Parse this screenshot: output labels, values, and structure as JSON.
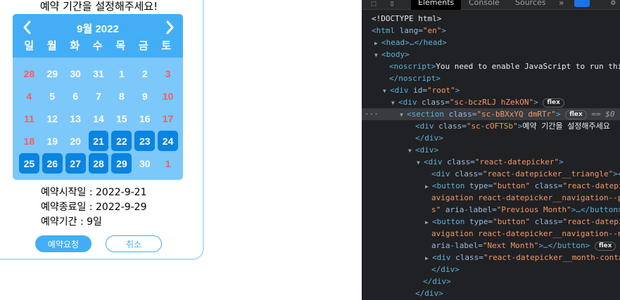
{
  "page": {
    "heading": "예약 기간을 설정해주세요!"
  },
  "datepicker": {
    "month_title": "9월 2022",
    "weekdays": [
      "일",
      "월",
      "화",
      "수",
      "목",
      "금",
      "토"
    ],
    "weeks": [
      [
        "28",
        "29",
        "30",
        "31",
        "1",
        "2",
        "3"
      ],
      [
        "4",
        "5",
        "6",
        "7",
        "8",
        "9",
        "10"
      ],
      [
        "11",
        "12",
        "13",
        "14",
        "15",
        "16",
        "17"
      ],
      [
        "18",
        "19",
        "20",
        "21",
        "22",
        "23",
        "24"
      ],
      [
        "25",
        "26",
        "27",
        "28",
        "29",
        "30",
        "1"
      ]
    ],
    "selected_range": {
      "start": "21",
      "end": "29"
    },
    "accent": "#43aef6",
    "selected_color": "#0a84e0",
    "weekend_color": "#ff5b5b"
  },
  "info": {
    "start": "예약시작일 : 2022-9-21",
    "end": "예약종료일 : 2022-9-29",
    "period": "예약기간 : 9일"
  },
  "buttons": {
    "request": "예약요청",
    "cancel": "취소"
  },
  "devtools": {
    "tabs": [
      "Elements",
      "Console",
      "Sources"
    ],
    "more": "»",
    "lines": {
      "l1": "<!DOCTYPE html>",
      "l2_tag": "<html",
      "l2_attr": " lang=",
      "l2_val": "\"en\"",
      "l2_end": ">",
      "l3": "<head>…</head>",
      "l4": "<body>",
      "l5_tag": "<noscript>",
      "l5_text": "You need to enable JavaScript to run thi",
      "l6": "</noscript>",
      "l7_tag": "<div",
      "l7_attr": " id=",
      "l7_val": "\"root\"",
      "l7_end": ">",
      "l8_tag": "<div",
      "l8_attr": " class=",
      "l8_val": "\"sc-bczRLJ hZekON\"",
      "l8_end": ">",
      "l8_pill": "flex",
      "l9_tag": "<section",
      "l9_attr": " class=",
      "l9_val": "\"sc-bBXxYQ dmRTr\"",
      "l9_end": ">",
      "l9_pill": "flex",
      "l9_eq": "== $0",
      "l10_tag": "<div",
      "l10_attr": " class=",
      "l10_val": "\"sc-cOFTSb\"",
      "l10_end": ">",
      "l10_text": "예약 기간을 설정해주세요",
      "l11": "</div>",
      "l12": "<div>",
      "l13_tag": "<div",
      "l13_attr": " class=",
      "l13_val": "\"react-datepicker\"",
      "l13_end": ">",
      "l14_tag": "<div",
      "l14_attr": " class=",
      "l14_val": "\"react-datepicker__triangle\"",
      "l14_end": "><",
      "l15_tag": "<button",
      "l15_attr": " type=",
      "l15_val": "\"button\"",
      "l15_attr2": " class=",
      "l15_val2": "\"react-datepi",
      "l16_val": "avigation react-datepicker__navigation--p",
      "l17_val": "s\"",
      "l17_attr": " aria-label=",
      "l17_val2": "\"Previous Month\"",
      "l17_end": ">…</button>",
      "l18_tag": "<button",
      "l18_attr": " type=",
      "l18_val": "\"button\"",
      "l18_attr2": " class=",
      "l18_val2": "\"react-datepi",
      "l19_val": "avigation react-datepicker__navigation--n",
      "l20_attr": "aria-label=",
      "l20_val": "\"Next Month\"",
      "l20_end": ">…</button>",
      "l20_pill": "flex",
      "l21_tag": "<div",
      "l21_attr": " class=",
      "l21_val": "\"react-datepicker__month-conta",
      "l22": "</div>",
      "l23": "</div>",
      "l24": "</div>"
    }
  }
}
